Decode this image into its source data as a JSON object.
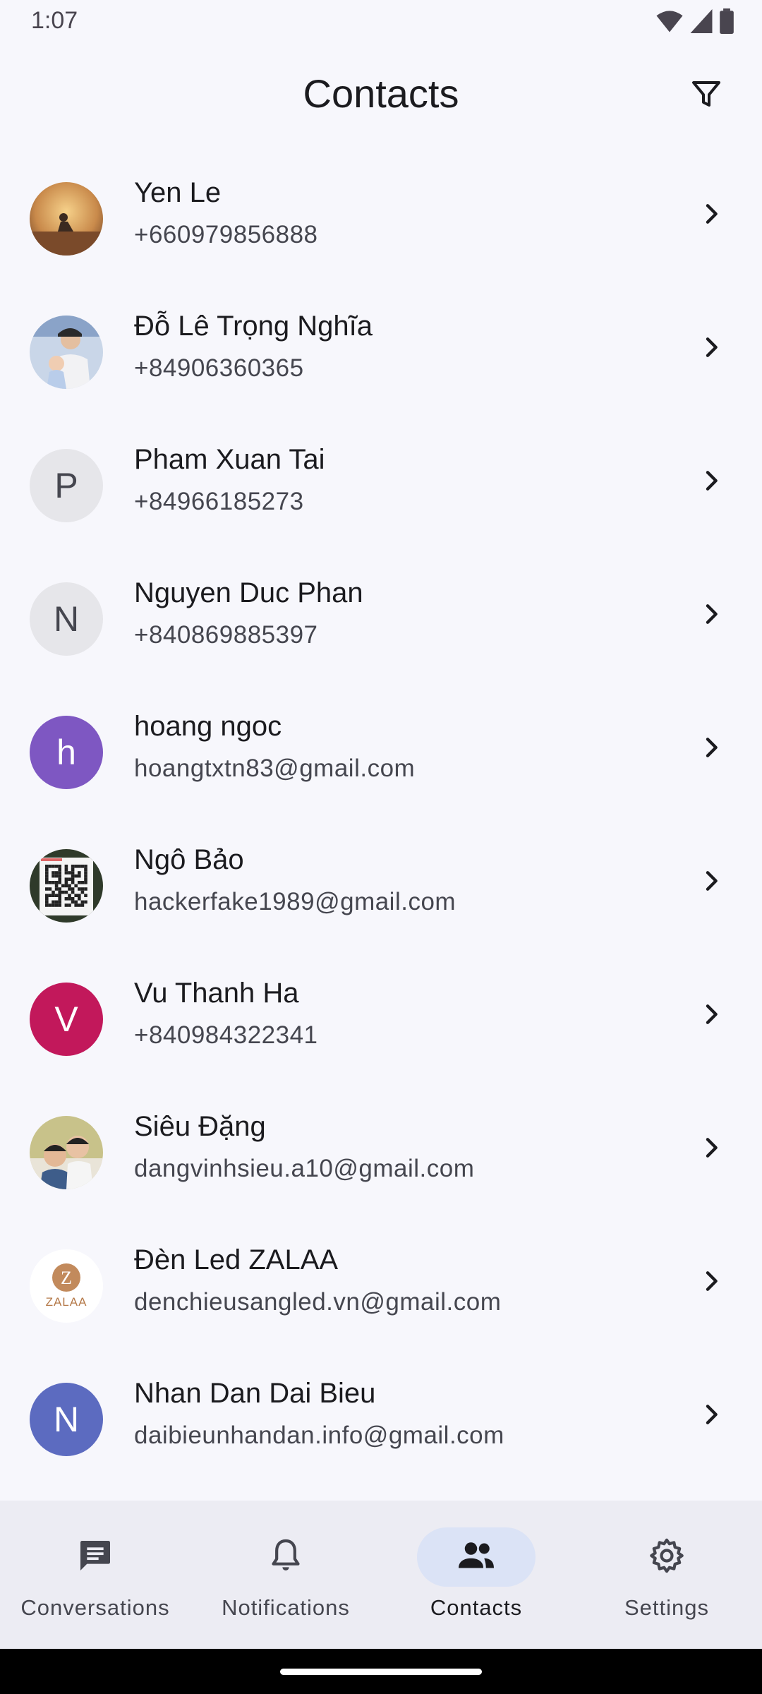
{
  "status": {
    "time": "1:07"
  },
  "header": {
    "title": "Contacts",
    "filter_icon": "filter-icon"
  },
  "contacts": [
    {
      "name": "Yen Le",
      "detail": "+660979856888",
      "avatar": {
        "type": "photo",
        "kind": "sunset-person"
      }
    },
    {
      "name": "Đỗ Lê Trọng Nghĩa",
      "detail": "+84906360365",
      "avatar": {
        "type": "photo",
        "kind": "man-with-baby"
      }
    },
    {
      "name": "Pham Xuan Tai",
      "detail": "+84966185273",
      "avatar": {
        "type": "letter",
        "letter": "P",
        "bg": "#e6e6ea",
        "fg": "#45464f"
      }
    },
    {
      "name": "Nguyen Duc Phan",
      "detail": "+840869885397",
      "avatar": {
        "type": "letter",
        "letter": "N",
        "bg": "#e6e6ea",
        "fg": "#45464f"
      }
    },
    {
      "name": "hoang ngoc",
      "detail": "hoangtxtn83@gmail.com",
      "avatar": {
        "type": "letter",
        "letter": "h",
        "bg": "#7e57c2",
        "fg": "#ffffff"
      }
    },
    {
      "name": "Ngô Bảo",
      "detail": "hackerfake1989@gmail.com",
      "avatar": {
        "type": "photo",
        "kind": "qr-code"
      }
    },
    {
      "name": "Vu Thanh Ha",
      "detail": "+840984322341",
      "avatar": {
        "type": "letter",
        "letter": "V",
        "bg": "#c2185b",
        "fg": "#ffffff"
      }
    },
    {
      "name": "Siêu Đặng",
      "detail": "dangvinhsieu.a10@gmail.com",
      "avatar": {
        "type": "photo",
        "kind": "two-people"
      }
    },
    {
      "name": "Đèn Led ZALAA",
      "detail": "denchieusangled.vn@gmail.com",
      "avatar": {
        "type": "logo",
        "kind": "zalaa",
        "logo_letter": "Z",
        "logo_text": "ZALAA"
      }
    },
    {
      "name": "Nhan Dan Dai Bieu",
      "detail": "daibieunhandan.info@gmail.com",
      "avatar": {
        "type": "letter",
        "letter": "N",
        "bg": "#5c6bc0",
        "fg": "#ffffff"
      }
    }
  ],
  "nav": {
    "items": [
      {
        "label": "Conversations",
        "icon": "chat-icon",
        "active": false
      },
      {
        "label": "Notifications",
        "icon": "bell-icon",
        "active": false
      },
      {
        "label": "Contacts",
        "icon": "people-icon",
        "active": true
      },
      {
        "label": "Settings",
        "icon": "gear-icon",
        "active": false
      }
    ]
  },
  "colors": {
    "background": "#f7f7fc",
    "nav_background": "#ececf3",
    "nav_active_pill": "#dbe3f6"
  }
}
